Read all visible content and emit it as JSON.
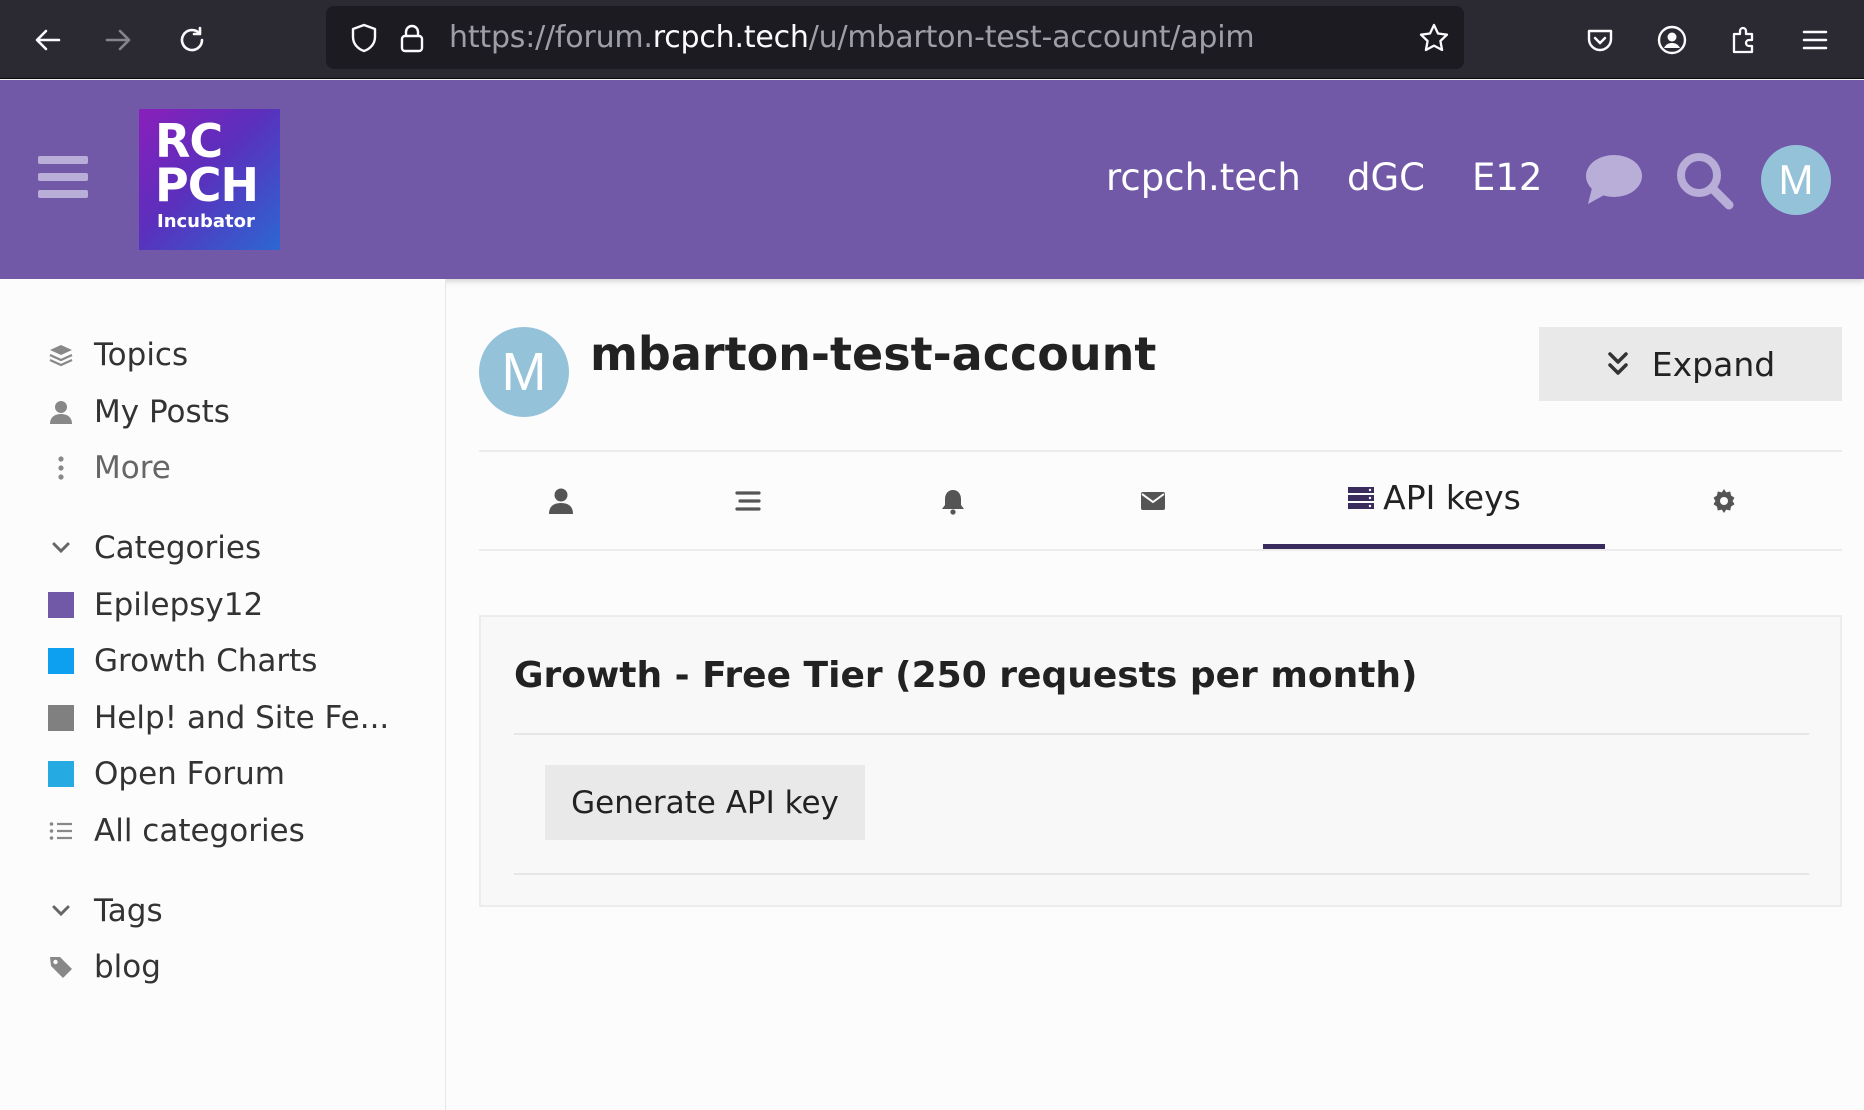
{
  "browser": {
    "url_scheme": "https://forum.",
    "url_host": "rcpch.tech",
    "url_path": "/u/mbarton-test-account/apim"
  },
  "header": {
    "logo_line1": "RC",
    "logo_line2": "PCH",
    "logo_line3": "Incubator",
    "links": [
      "rcpch.tech",
      "dGC",
      "E12"
    ],
    "avatar_letter": "M",
    "brand_color": "#7159a8"
  },
  "sidebar": {
    "top_items": [
      {
        "label": "Topics",
        "icon": "layers-icon"
      },
      {
        "label": "My Posts",
        "icon": "user-icon"
      },
      {
        "label": "More",
        "icon": "vertical-ellipsis-icon"
      }
    ],
    "categories_heading": "Categories",
    "categories": [
      {
        "label": "Epilepsy12",
        "color": "#7159a8"
      },
      {
        "label": "Growth Charts",
        "color": "#0ea0f0"
      },
      {
        "label": "Help! and Site Fe...",
        "color": "#808080"
      },
      {
        "label": "Open Forum",
        "color": "#25aae1"
      }
    ],
    "all_categories": "All categories",
    "tags_heading": "Tags",
    "tags": [
      {
        "label": "blog",
        "icon": "tag-icon"
      }
    ]
  },
  "profile": {
    "avatar_letter": "M",
    "username": "mbarton-test-account",
    "expand_label": "Expand"
  },
  "tabs": {
    "active_label": "API keys",
    "icons": [
      "user-icon",
      "stream-icon",
      "bell-icon",
      "envelope-icon",
      "server-icon",
      "gear-icon"
    ]
  },
  "api": {
    "title": "Growth - Free Tier (250 requests per month)",
    "button_label": "Generate API key"
  }
}
